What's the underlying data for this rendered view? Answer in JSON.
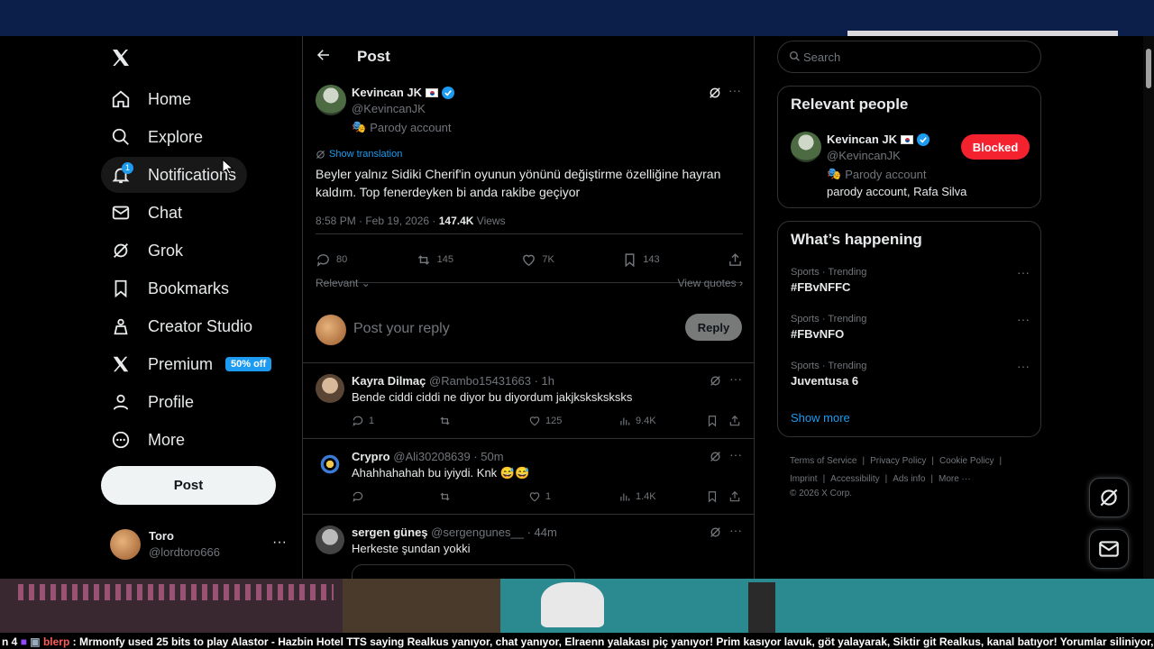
{
  "nav": {
    "items": [
      {
        "label": "Home",
        "icon": "home-icon"
      },
      {
        "label": "Explore",
        "icon": "search-icon"
      },
      {
        "label": "Notifications",
        "icon": "bell-icon",
        "badge": "1"
      },
      {
        "label": "Chat",
        "icon": "mail-icon"
      },
      {
        "label": "Grok",
        "icon": "grok-icon"
      },
      {
        "label": "Bookmarks",
        "icon": "bookmark-icon"
      },
      {
        "label": "Creator Studio",
        "icon": "creator-icon"
      },
      {
        "label": "Premium",
        "icon": "x-icon",
        "badge": "50% off"
      },
      {
        "label": "Profile",
        "icon": "person-icon"
      },
      {
        "label": "More",
        "icon": "more-circle-icon"
      }
    ],
    "post_button": "Post",
    "account": {
      "name": "Toro",
      "handle": "@lordtoro666"
    }
  },
  "header": {
    "title": "Post"
  },
  "main_post": {
    "name": "Kevincan JK",
    "handle": "@KevincanJK",
    "parody": "Parody account",
    "show_translation": "Show translation",
    "text": "Beyler yalnız Sidiki Cherif'in oyunun yönünü değiştirme özelliğine hayran kaldım. Top fenerdeyken bi anda rakibe geçiyor",
    "time": "8:58 PM · Feb 19, 2026 · ",
    "views": "147.4K",
    "views_label": " Views",
    "stats": {
      "replies": "80",
      "reposts": "145",
      "likes": "7K",
      "bookmarks": "143"
    },
    "sort": "Relevant",
    "view_quotes": "View quotes"
  },
  "reply_box": {
    "placeholder": "Post your reply",
    "button": "Reply"
  },
  "replies": [
    {
      "name": "Kayra Dilmaç",
      "handle": "@Rambo15431663",
      "time": "· 1h",
      "text": "Bende ciddi ciddi ne diyor bu diyordum jakjksksksksks",
      "replies": "1",
      "reposts": "",
      "likes": "125",
      "views": "9.4K"
    },
    {
      "name": "Crypro",
      "handle": "@Ali30208639",
      "time": "· 50m",
      "text": "Ahahhahahah bu iyiydi. Knk 😅😅",
      "replies": "",
      "reposts": "",
      "likes": "1",
      "views": "1.4K"
    },
    {
      "name": "sergen güneş",
      "handle": "@sergengunes__",
      "time": "· 44m",
      "text": "Herkeste şundan yokki"
    }
  ],
  "search": {
    "placeholder": "Search"
  },
  "relevant": {
    "title": "Relevant people",
    "name": "Kevincan JK",
    "handle": "@KevincanJK",
    "parody": "Parody account",
    "bio": "parody account, Rafa Silva",
    "button": "Blocked"
  },
  "happening": {
    "title": "What’s happening",
    "trends": [
      {
        "category": "Sports · Trending",
        "title": "#FBvNFFC"
      },
      {
        "category": "Sports · Trending",
        "title": "#FBvNFO"
      },
      {
        "category": "Sports · Trending",
        "title": "Juventusa 6"
      }
    ],
    "show_more": "Show more"
  },
  "footer": {
    "links": [
      "Terms of Service",
      "|",
      "Privacy Policy",
      "|",
      "Cookie Policy",
      "|",
      "Imprint",
      "|",
      "Accessibility",
      "|",
      "Ads info",
      "|",
      "More ···"
    ],
    "copyright": "© 2026 X Corp."
  },
  "ticker": {
    "prefix": "n 4",
    "user": "blerp",
    "message": ": Mrmonfy used 25 bits to play Alastor - Hazbin Hotel TTS saying Realkus yanıyor, chat yanıyor, Elraenn yalakası piç yanıyor! Prim kasıyor lavuk, göt yalayarak, Siktir git Realkus, kanal batıyor! Yorumlar siliniyor,"
  },
  "colors": {
    "accent": "#1d9bf0",
    "blocked": "#f4212e",
    "background": "#000000"
  }
}
